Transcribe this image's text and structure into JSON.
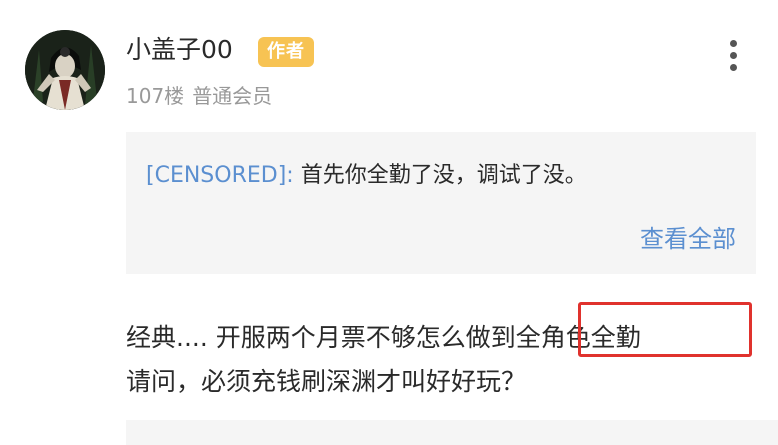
{
  "post": {
    "username": "小盖子00",
    "author_badge": "作者",
    "floor": "107楼",
    "member_level": "普通会员",
    "quote": {
      "user": "[CENSORED]:",
      "text": " 首先你全勤了没，调试了没。",
      "view_all": "查看全部"
    },
    "body": {
      "line1_part1": "经典.... 开服两个月票不够怎么做到",
      "line1_highlight": "全角色全勤",
      "line2": "请问，必须充钱刷深渊才叫好好玩？"
    }
  },
  "colors": {
    "badge_bg": "#f7c353",
    "link_blue": "#5b8fd0",
    "highlight_red": "#e0322d",
    "quote_bg": "#f5f5f5"
  },
  "icons": {
    "more": "more-vertical-icon",
    "avatar": "user-avatar-image"
  }
}
